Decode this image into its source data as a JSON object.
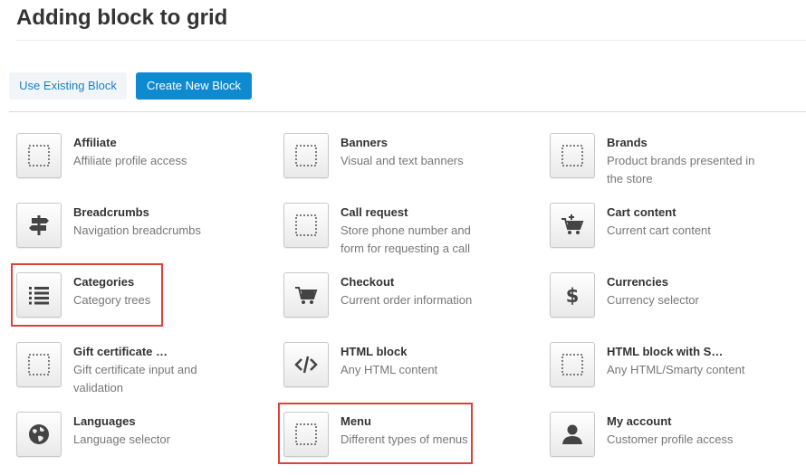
{
  "page": {
    "title": "Adding block to grid"
  },
  "tabs": {
    "existing_label": "Use Existing Block",
    "new_label": "Create New Block"
  },
  "colors": {
    "accent": "#0e8ad1",
    "link": "#1b82c6",
    "highlight": "#e0403a"
  },
  "blocks": [
    {
      "name": "Affiliate",
      "desc": "Affiliate profile access",
      "icon": "dotted-square-icon"
    },
    {
      "name": "Banners",
      "desc": "Visual and text banners",
      "icon": "dotted-square-icon"
    },
    {
      "name": "Brands",
      "desc": "Product brands presented in the store",
      "icon": "dotted-square-icon"
    },
    {
      "name": "Breadcrumbs",
      "desc": "Navigation breadcrumbs",
      "icon": "signpost-icon"
    },
    {
      "name": "Call request",
      "desc": "Store phone number and form for requesting a call",
      "icon": "dotted-square-icon"
    },
    {
      "name": "Cart content",
      "desc": "Current cart content",
      "icon": "cart-add-icon"
    },
    {
      "name": "Categories",
      "desc": "Category trees",
      "icon": "list-icon",
      "highlighted": true
    },
    {
      "name": "Checkout",
      "desc": "Current order information",
      "icon": "cart-icon"
    },
    {
      "name": "Currencies",
      "desc": "Currency selector",
      "icon": "dollar-icon"
    },
    {
      "name": "Gift certificate …",
      "desc": "Gift certificate input and validation",
      "icon": "dotted-square-icon"
    },
    {
      "name": "HTML block",
      "desc": "Any HTML content",
      "icon": "code-icon"
    },
    {
      "name": "HTML block with S…",
      "desc": "Any HTML/Smarty content",
      "icon": "dotted-square-icon"
    },
    {
      "name": "Languages",
      "desc": "Language selector",
      "icon": "globe-icon"
    },
    {
      "name": "Menu",
      "desc": "Different types of menus",
      "icon": "dotted-square-icon",
      "highlighted": true
    },
    {
      "name": "My account",
      "desc": "Customer profile access",
      "icon": "user-icon"
    }
  ]
}
